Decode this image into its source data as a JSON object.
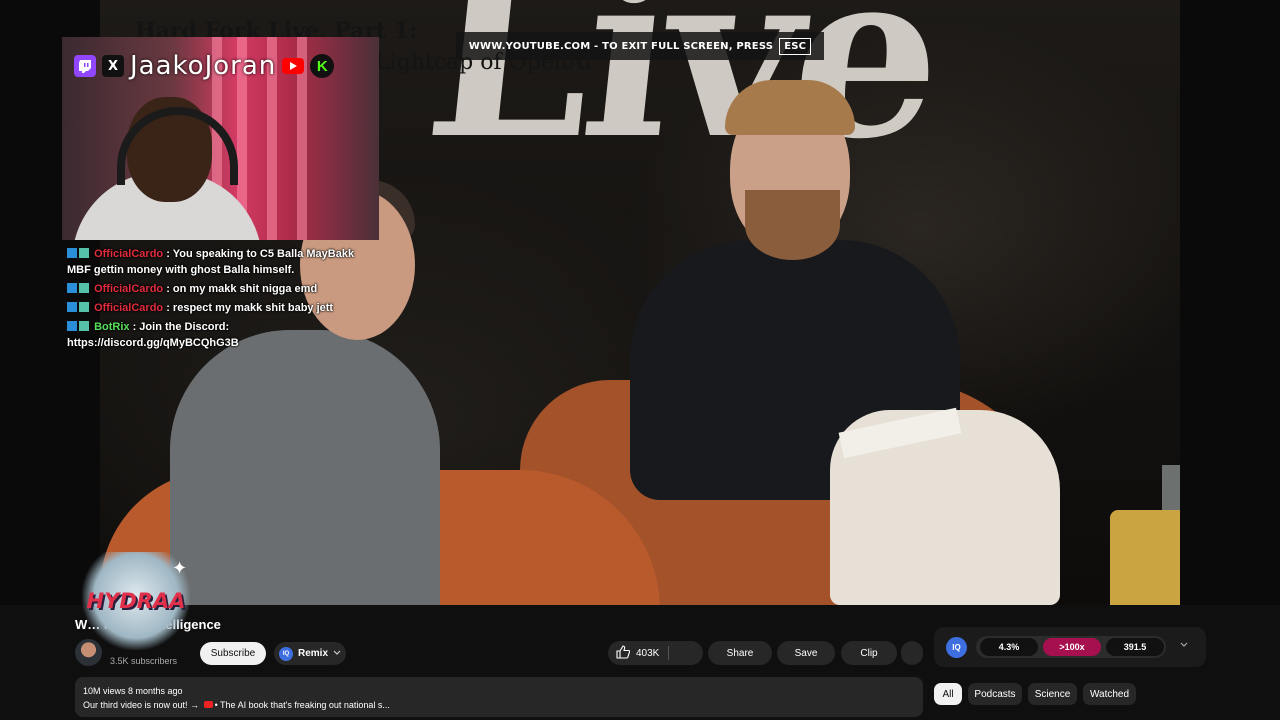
{
  "video": {
    "title_line1": "Hard Fork Live, Part 1:",
    "title_line2": "Lightcap of OpenAI",
    "bg_text": "Live"
  },
  "fullscreen_notice": {
    "text": "WWW.YOUTUBE.COM - TO EXIT FULL SCREEN, PRESS",
    "key": "ESC"
  },
  "streamer": {
    "name": "JaakoJoran",
    "icons": [
      "twitch-icon",
      "x-icon",
      "youtube-icon",
      "kick-icon"
    ],
    "x_glyph": "X",
    "kick_glyph": "K"
  },
  "chat": {
    "messages": [
      {
        "user": "OfficialCardo",
        "text": ": You speaking to C5 Balla MayBakk MBF gettin money with ghost Balla himself."
      },
      {
        "user": "OfficialCardo",
        "text": ": on my makk shit nigga emd"
      },
      {
        "user": "OfficialCardo",
        "text": ": respect my makk shit baby jett"
      },
      {
        "user": "BotRix",
        "text": ": Join the Discord: https://discord.gg/qMyBCQhG3B"
      }
    ]
  },
  "overlay": {
    "hydra_text": "HYDRAA",
    "sparkle": "✦"
  },
  "page": {
    "video_title": "W… r Superintelligence",
    "subscribers": "3.5K subscribers",
    "subscribe_label": "Subscribe",
    "remix_label": "Remix",
    "likes": "403K",
    "share_label": "Share",
    "save_label": "Save",
    "clip_label": "Clip",
    "views_date": "10M views  8 months ago",
    "description": "Our third video is now out! → ",
    "description_link": "• The AI book that's freaking out national s..."
  },
  "iq_panel": {
    "logo": "IQ",
    "stat1": "4.3%",
    "stat2": ">100x",
    "stat3": "391.5"
  },
  "chips": [
    "All",
    "Podcasts",
    "Science",
    "Watched"
  ],
  "colors": {
    "chat_user": "#e22b3c",
    "bot_user": "#58e05a",
    "accent_pink": "#a7104f",
    "iq_blue": "#3e6fe0"
  }
}
